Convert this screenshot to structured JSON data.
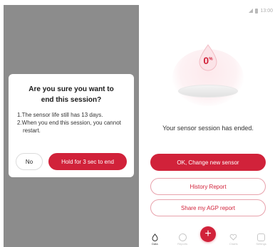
{
  "dialog": {
    "title": "Are you sure you want to end this session?",
    "line1": "1.The sensor life still has 13 days.",
    "line2a": "2.When you end this session, you cannot",
    "line2b": "restart.",
    "no_label": "No",
    "hold_label": "Hold for 3 sec to end"
  },
  "status": {
    "time": "13:00"
  },
  "sensor": {
    "value": "0",
    "unit": "%",
    "ended_text": "Your sensor session has ended."
  },
  "actions": {
    "change_label": "OK, Change new sensor",
    "history_label": "History Report",
    "share_label": "Share my AGP report"
  },
  "tabs": [
    {
      "label": "Data",
      "icon": "drop-icon"
    },
    {
      "label": "Reports",
      "icon": "chat-icon"
    },
    {
      "label": "Charts",
      "icon": "heart-icon"
    },
    {
      "label": "Settings",
      "icon": "message-icon"
    }
  ],
  "colors": {
    "accent": "#d1223a",
    "overlay": "#8c8c8c"
  }
}
